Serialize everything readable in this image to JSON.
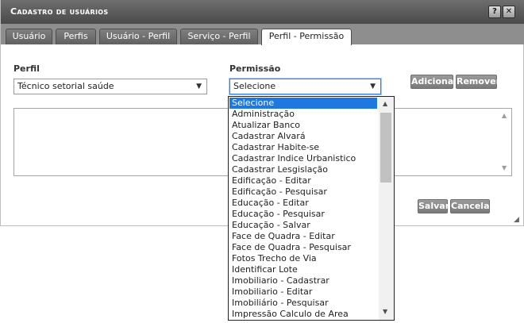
{
  "dialog": {
    "title": "Cadastro de usuários",
    "help_label": "?",
    "close_label": "✕"
  },
  "tabs": [
    {
      "label": "Usuário"
    },
    {
      "label": "Perfis"
    },
    {
      "label": "Usuário - Perfil"
    },
    {
      "label": "Serviço - Perfil"
    },
    {
      "label": "Perfil - Permissão",
      "active": true
    }
  ],
  "form": {
    "perfil_label": "Perfil",
    "perfil_value": "Técnico setorial saúde",
    "permissao_label": "Permissão",
    "permissao_value": "Selecione",
    "add_label": "Adicionar",
    "remove_label": "Remover",
    "save_label": "Salvar",
    "cancel_label": "Cancelar"
  },
  "dropdown": {
    "options": [
      "Selecione",
      "Administração",
      "Atualizar Banco",
      "Cadastrar Alvará",
      "Cadastrar Habite-se",
      "Cadastrar Indice Urbanistico",
      "Cadastrar Lesgislação",
      "Edificação - Editar",
      "Edificação - Pesquisar",
      "Educação - Editar",
      "Educação - Pesquisar",
      "Educação - Salvar",
      "Face de Quadra - Editar",
      "Face de Quadra - Pesquisar",
      "Fotos Trecho de Via",
      "Identificar Lote",
      "Imobiliario - Cadastrar",
      "Imobiliario - Editar",
      "Imobiliário - Pesquisar",
      "Impressão Calculo de Area"
    ],
    "selected_index": 0
  },
  "colors": {
    "titlebar": "#555555",
    "selection": "#1f78e0",
    "focus_border": "#3c7fd8"
  }
}
